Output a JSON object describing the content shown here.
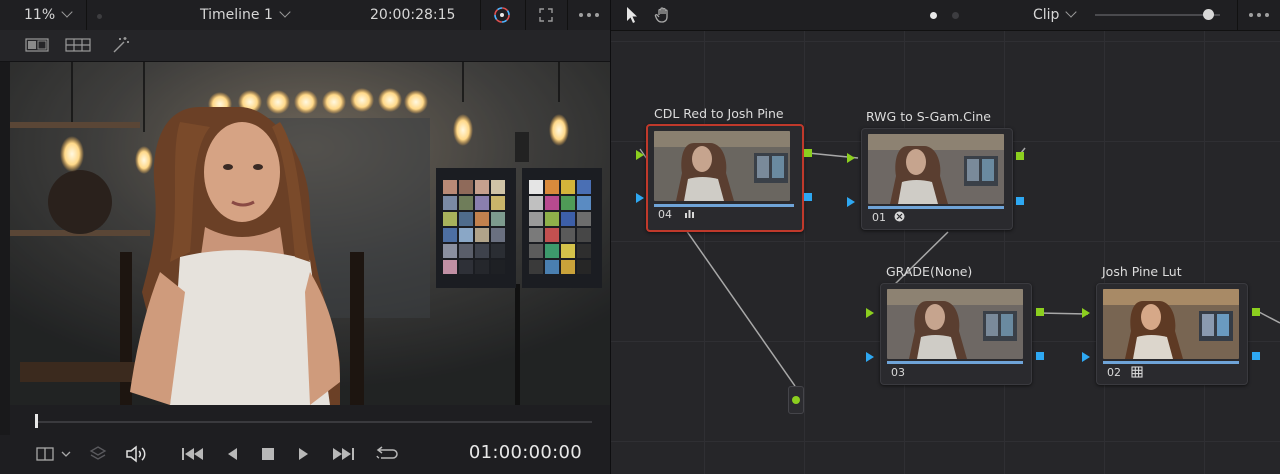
{
  "viewer": {
    "zoom": "11%",
    "timeline_name": "Timeline 1",
    "timecode_top": "20:00:28:15",
    "timecode_bottom": "01:00:00:00"
  },
  "nodegraph": {
    "mode_label": "Clip",
    "nodes": [
      {
        "label": "CDL Red to Josh Pine",
        "number": "04",
        "icon": "bars-icon",
        "selected": true
      },
      {
        "label": "RWG to S-Gam.Cine",
        "number": "01",
        "icon": "cube-icon",
        "selected": false
      },
      {
        "label": "GRADE(None)",
        "number": "03",
        "icon": "",
        "selected": false
      },
      {
        "label": "Josh Pine Lut",
        "number": "02",
        "icon": "grid-icon",
        "selected": false
      }
    ]
  },
  "colors": {
    "selected_border": "#c0392b",
    "rgb_port": "#8ccf1f",
    "alpha_port": "#2ea8f2",
    "node_bar": "#6fa4d8"
  }
}
